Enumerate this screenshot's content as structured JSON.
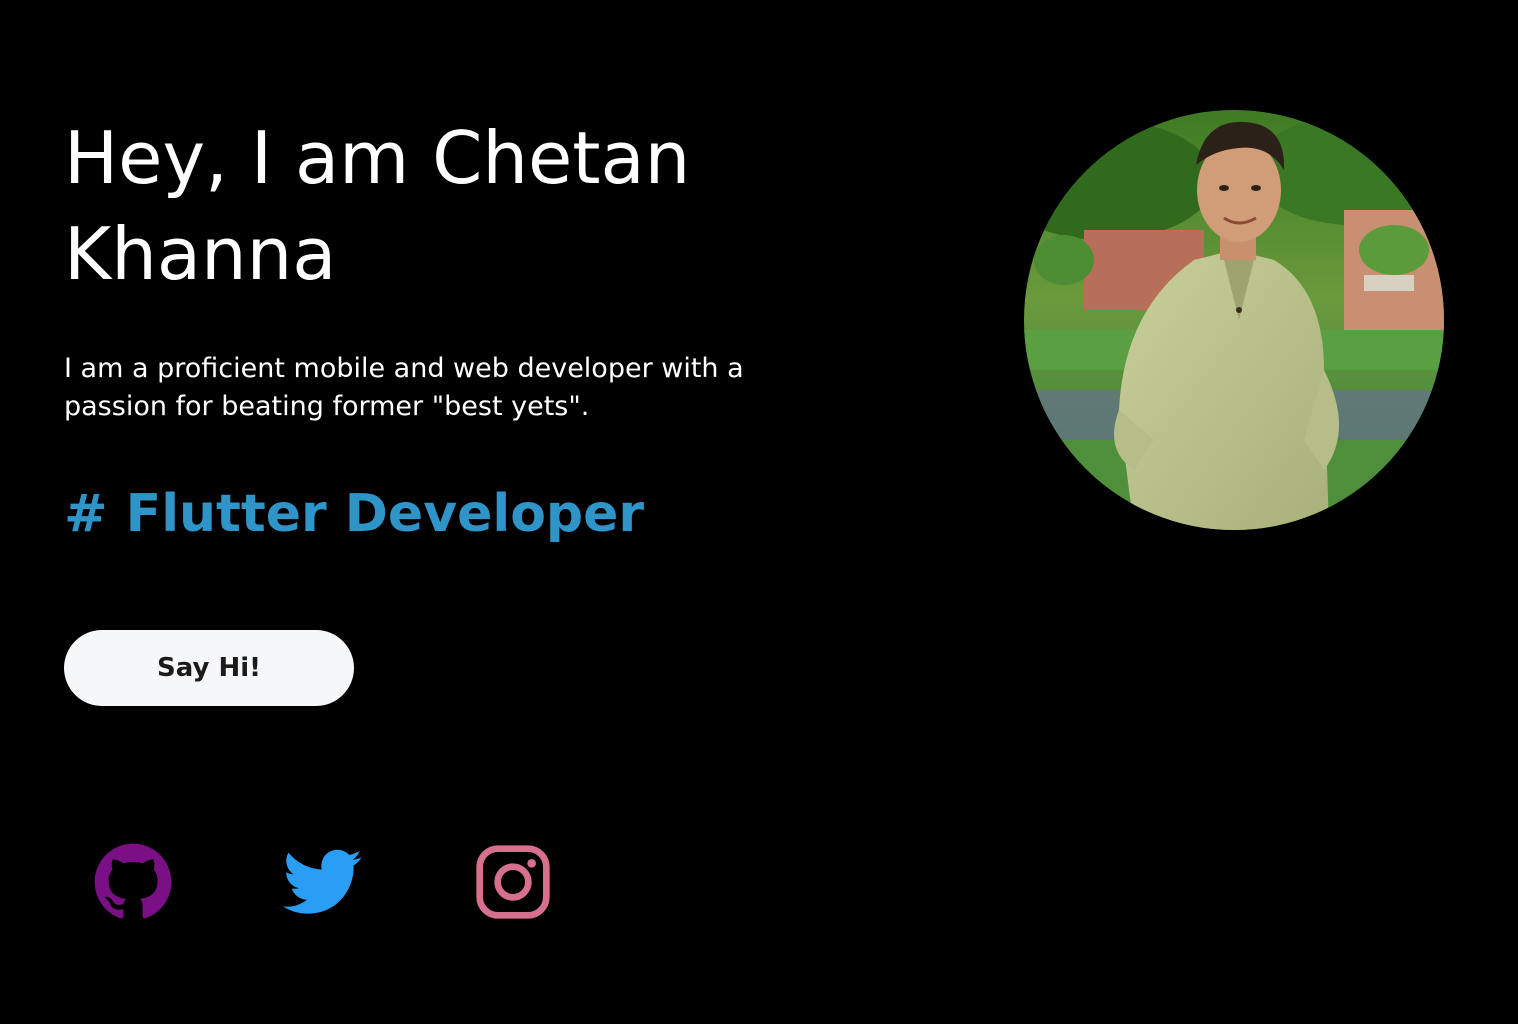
{
  "hero": {
    "title": "Hey, I am Chetan Khanna",
    "bio": "I am a proficient mobile and web developer with a passion for beating former \"best yets\".",
    "role": "# Flutter Developer",
    "role_color": "#2f95c8",
    "cta_label": "Say Hi!"
  },
  "socials": [
    {
      "icon": "github-icon",
      "color": "#7b0f86"
    },
    {
      "icon": "twitter-icon",
      "color": "#2a9df4"
    },
    {
      "icon": "instagram-icon",
      "color": "#d6708e"
    }
  ],
  "colors": {
    "background": "#000000",
    "text": "#ffffff",
    "button_bg": "#f6f7f9"
  }
}
